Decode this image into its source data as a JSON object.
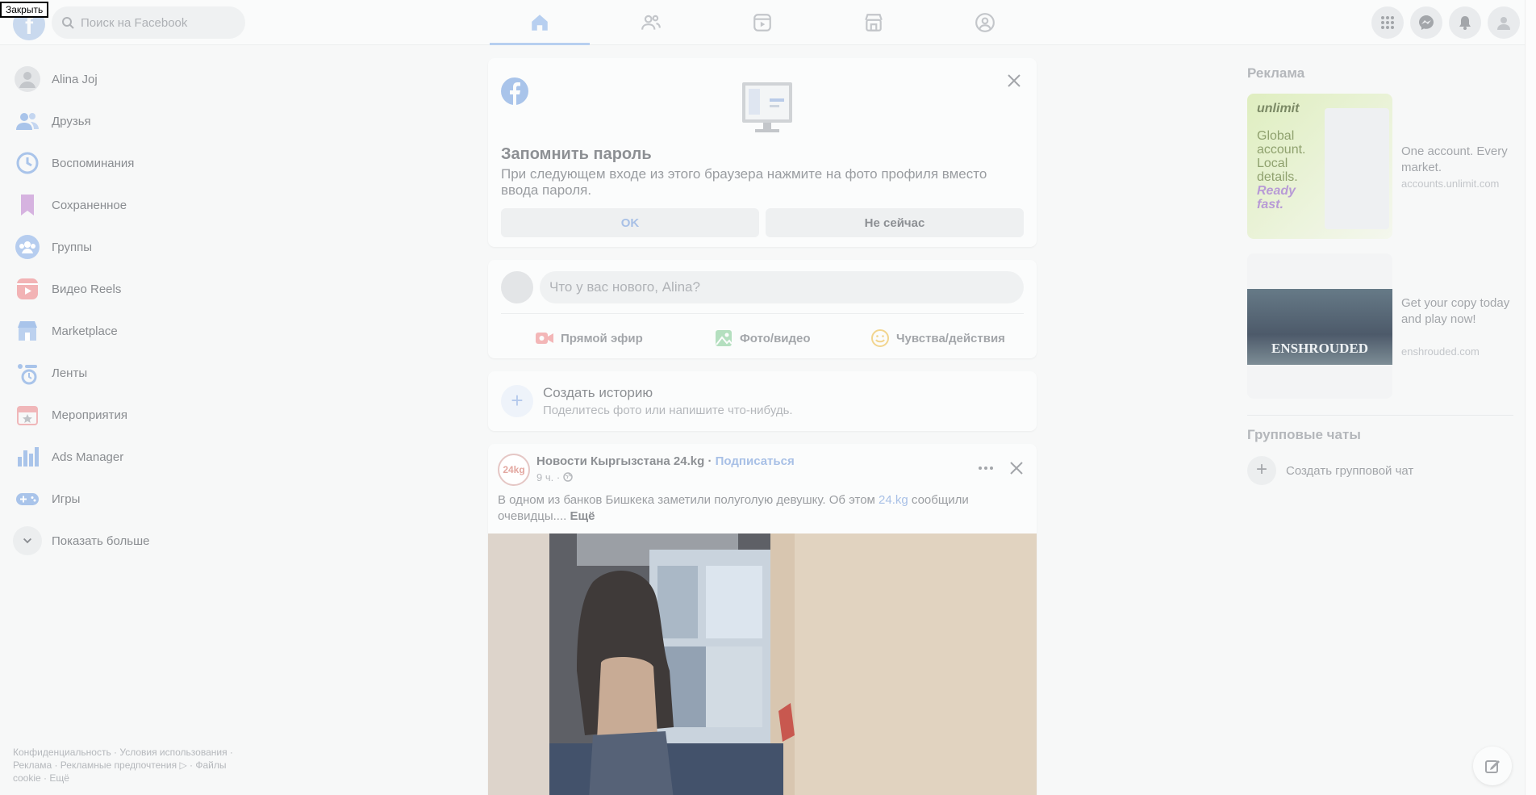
{
  "tooltip": "Закрыть",
  "search": {
    "placeholder": "Поиск на Facebook"
  },
  "nav_tabs": [
    "home-icon",
    "friends-icon",
    "video-icon",
    "marketplace-icon",
    "groups-icon"
  ],
  "sidebar": {
    "items": [
      {
        "label": "Alina Joj",
        "icon": "avatar-icon"
      },
      {
        "label": "Друзья",
        "icon": "friends-icon"
      },
      {
        "label": "Воспоминания",
        "icon": "memories-icon"
      },
      {
        "label": "Сохраненное",
        "icon": "saved-icon"
      },
      {
        "label": "Группы",
        "icon": "groups-icon"
      },
      {
        "label": "Видео Reels",
        "icon": "reels-icon"
      },
      {
        "label": "Marketplace",
        "icon": "marketplace-icon"
      },
      {
        "label": "Ленты",
        "icon": "feeds-icon"
      },
      {
        "label": "Мероприятия",
        "icon": "events-icon"
      },
      {
        "label": "Ads Manager",
        "icon": "ads-manager-icon"
      },
      {
        "label": "Игры",
        "icon": "games-icon"
      },
      {
        "label": "Показать больше",
        "icon": "chevron-down-icon"
      }
    ],
    "footer": "Конфиденциальность · Условия использования · Реклама · Рекламные предпочтения ▷ · Файлы cookie · Ещё"
  },
  "remember_password": {
    "title": "Запомнить пароль",
    "description": "При следующем входе из этого браузера нажмите на фото профиля вместо ввода пароля.",
    "ok_label": "OK",
    "not_now_label": "Не сейчас"
  },
  "composer": {
    "placeholder": "Что у вас нового, Alina?",
    "live_label": "Прямой эфир",
    "photo_label": "Фото/видео",
    "feeling_label": "Чувства/действия"
  },
  "story": {
    "title": "Создать историю",
    "subtitle": "Поделитесь фото или напишите что-нибудь."
  },
  "post": {
    "avatar_text": "24kg",
    "author": "Новости Кыргызстана 24.kg",
    "separator": " · ",
    "subscribe": "Подписаться",
    "time": "9 ч. ·",
    "text_before": "В одном из банков Бишкека заметили полуголую девушку. Об этом ",
    "text_link": "24.kg",
    "text_after": " сообщили очевидцы.... ",
    "more": "Ещё"
  },
  "right": {
    "ads_heading": "Реклама",
    "ads": [
      {
        "img_text": "unlimit",
        "img_slogan": "Global account. Local details.",
        "img_slogan2": "Ready fast.",
        "title": "One account. Every market.",
        "url": "accounts.unlimit.com"
      },
      {
        "img_text": "ENSHROUDED",
        "title": "Get your copy today and play now!",
        "url": "enshrouded.com"
      }
    ],
    "group_chats_heading": "Групповые чаты",
    "create_group_label": "Создать групповой чат"
  }
}
